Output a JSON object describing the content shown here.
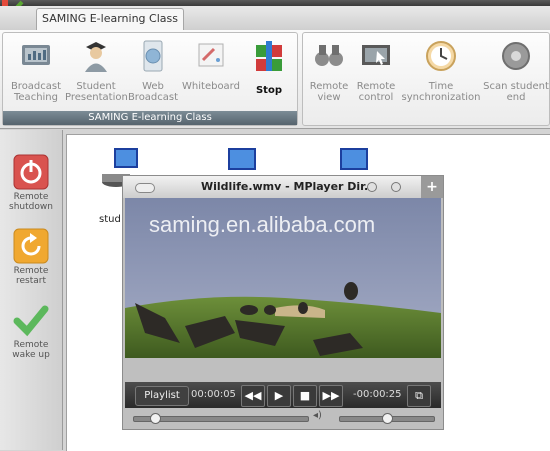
{
  "tab": {
    "label": "SAMING E-learning Class"
  },
  "ribbon": {
    "group_1": {
      "label": "SAMING E-learning Class",
      "buttons": [
        {
          "label": "Broadcast Teaching",
          "icon": "broadcast-icon"
        },
        {
          "label": "Student Presentation",
          "icon": "student-presentation-icon"
        },
        {
          "label": "Web Broadcast",
          "icon": "web-broadcast-icon"
        },
        {
          "label": "Whiteboard",
          "icon": "whiteboard-icon"
        },
        {
          "label": "Stop",
          "icon": "stop-icon"
        }
      ]
    },
    "group_2": {
      "buttons": [
        {
          "label": "Remote view",
          "icon": "binoculars-icon"
        },
        {
          "label": "Remote control",
          "icon": "remote-control-icon"
        },
        {
          "label": "Time synchronization",
          "icon": "clock-icon"
        },
        {
          "label": "Scan student end",
          "icon": "scan-icon"
        }
      ]
    }
  },
  "sidebar": {
    "items": [
      {
        "label": "Remote shutdown",
        "icon": "power-icon"
      },
      {
        "label": "Remote restart",
        "icon": "restart-icon"
      },
      {
        "label": "Remote wake up",
        "icon": "checkmark-icon"
      }
    ]
  },
  "main": {
    "student_label": "stud"
  },
  "player": {
    "title": "Wildlife.wmv - MPlayer Dir...",
    "watermark": "saming.en.alibaba.com",
    "playlist_label": "Playlist",
    "elapsed": "00:00:05",
    "remaining": "-00:00:25",
    "progress": 0.12,
    "volume": 0.5
  },
  "colors": {
    "group_label_bg": "#56646e",
    "controls_bg": "#2a2a2a",
    "shutdown_red": "#d9534f",
    "restart_orange": "#f0a830",
    "wake_green": "#5cb85c"
  }
}
